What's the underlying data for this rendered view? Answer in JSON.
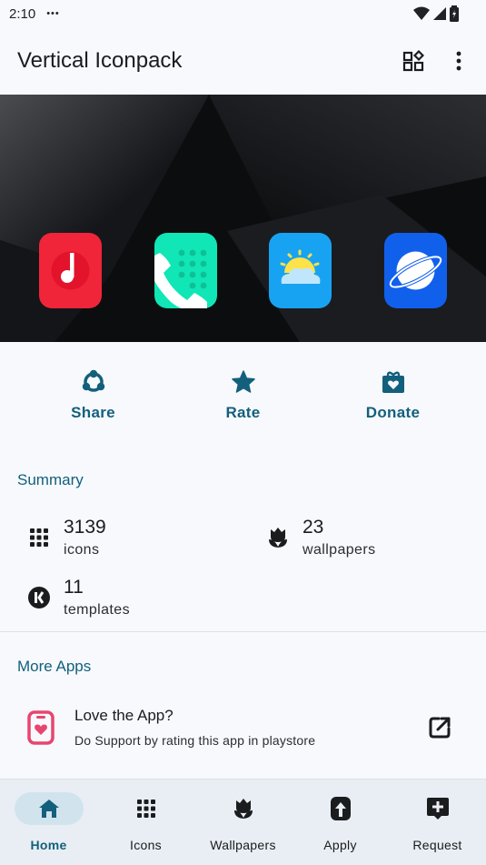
{
  "status": {
    "time": "2:10",
    "dots": "•••"
  },
  "appbar": {
    "title": "Vertical Iconpack"
  },
  "hero": {
    "icons": [
      {
        "name": "music-app-icon",
        "color": "#f0253a"
      },
      {
        "name": "phone-app-icon",
        "color": "#10e6b6"
      },
      {
        "name": "weather-app-icon",
        "color": "#18a3f2"
      },
      {
        "name": "browser-app-icon",
        "color": "#1160ec"
      }
    ]
  },
  "actions": {
    "share": "Share",
    "rate": "Rate",
    "donate": "Donate"
  },
  "summary": {
    "title": "Summary",
    "icons_count": "3139",
    "icons_label": "icons",
    "wallpapers_count": "23",
    "wallpapers_label": "wallpapers",
    "templates_count": "11",
    "templates_label": "templates"
  },
  "more_apps": {
    "title": "More Apps",
    "promo_title": "Love the App?",
    "promo_subtitle": "Do Support by rating this app in playstore"
  },
  "nav": {
    "home": "Home",
    "icons": "Icons",
    "wallpapers": "Wallpapers",
    "apply": "Apply",
    "request": "Request"
  },
  "colors": {
    "accent": "#13607c",
    "background": "#f7f9fd",
    "nav_bg": "#e8eef4",
    "nav_active_pill": "#d1e4ee"
  }
}
